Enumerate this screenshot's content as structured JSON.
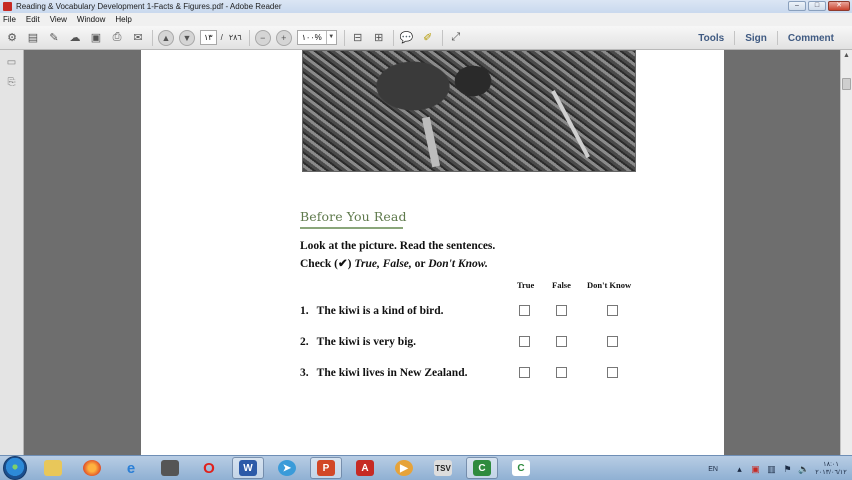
{
  "window": {
    "title": "Reading & Vocabulary Development 1-Facts & Figures.pdf - Adobe Reader",
    "controls": {
      "minimize": "–",
      "maximize": "□",
      "close": "✕"
    }
  },
  "menu": [
    "File",
    "Edit",
    "View",
    "Window",
    "Help"
  ],
  "toolbar": {
    "page_current": "١٣",
    "page_separator": "/",
    "page_total": "٢٨٦",
    "zoom": "١٠٠%",
    "right": {
      "tools": "Tools",
      "sign": "Sign",
      "comment": "Comment"
    }
  },
  "document": {
    "section_title": "Before You Read",
    "instruction_line1": "Look at the picture. Read the sentences.",
    "instruction_line2_prefix": "Check (",
    "check_mark": "✔",
    "instruction_line2_mid": ") ",
    "opt_true": "True,",
    "opt_false": "False,",
    "or_word": " or ",
    "opt_dont_know": "Don't Know.",
    "columns": [
      "True",
      "False",
      "Don't Know"
    ],
    "questions": [
      {
        "num": "1.",
        "text": "The kiwi is a kind of bird."
      },
      {
        "num": "2.",
        "text": "The kiwi is very big."
      },
      {
        "num": "3.",
        "text": "The kiwi lives in New Zealand."
      }
    ]
  },
  "tray": {
    "language": "EN",
    "time": "١٨:٠١",
    "date": "٢٠١٣/٠٦/١٢"
  },
  "taskbar": {
    "word": "W",
    "pdf_app": "A",
    "camtasia": "C",
    "camtasia2": "C",
    "opera": "O"
  }
}
